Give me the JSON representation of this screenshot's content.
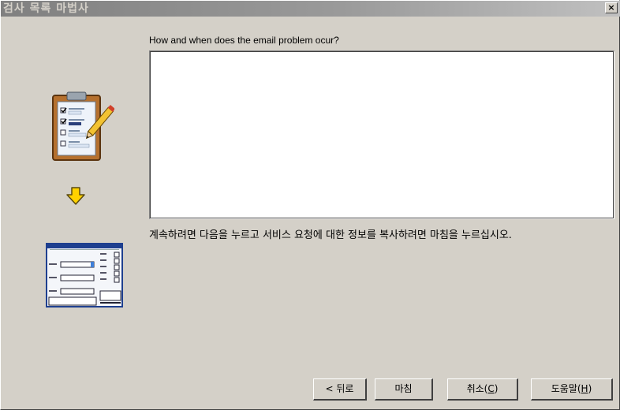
{
  "window": {
    "title": "검사 목록 마법사",
    "close_label": "×"
  },
  "main": {
    "question": "How and when does the email problem ocur?",
    "answer_value": "",
    "instruction": "계속하려면 다음을 누르고 서비스 요청에 대한 정보를 복사하려면 마침을 누르십시오."
  },
  "buttons": {
    "back": "< 뒤로",
    "finish": "마침",
    "cancel_prefix": "취소(",
    "cancel_key": "C",
    "cancel_suffix": ")",
    "help_prefix": "도움말(",
    "help_key": "H",
    "help_suffix": ")"
  },
  "icons": {
    "checklist": "clipboard-checklist-icon",
    "arrow": "down-arrow-icon",
    "form": "form-window-icon",
    "arrow_color": "#ffd200",
    "form_border": "#1e3f8f"
  }
}
